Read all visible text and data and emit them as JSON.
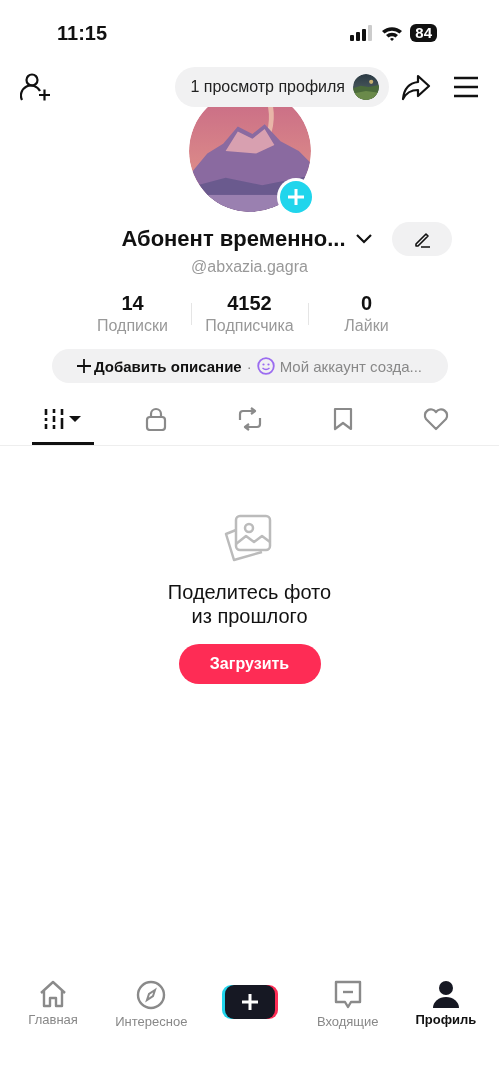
{
  "status_bar": {
    "time": "11:15",
    "battery": "84"
  },
  "top_bar": {
    "views_pill": "1 просмотр профиля"
  },
  "profile": {
    "name": "Абонент временно...",
    "username": "@abxazia.gagra",
    "stats": [
      {
        "value": "14",
        "label": "Подписки"
      },
      {
        "value": "4152",
        "label": "Подписчика"
      },
      {
        "value": "0",
        "label": "Лайки"
      }
    ],
    "bio": {
      "add_label": "Добавить описание",
      "separator": "·",
      "text": "Мой аккаунт созда..."
    }
  },
  "tabs": [
    {
      "kind": "grid",
      "selected": true
    },
    {
      "kind": "lock",
      "selected": false
    },
    {
      "kind": "repost",
      "selected": false
    },
    {
      "kind": "bookmark",
      "selected": false
    },
    {
      "kind": "heart",
      "selected": false
    }
  ],
  "empty_state": {
    "title": "Поделитесь фото\nиз прошлого",
    "button": "Загрузить"
  },
  "bottom_nav": [
    {
      "kind": "home",
      "label": "Главная",
      "selected": false
    },
    {
      "kind": "explore",
      "label": "Интересное",
      "selected": false
    },
    {
      "kind": "create",
      "selected": false
    },
    {
      "kind": "inbox",
      "label": "Входящие",
      "selected": false
    },
    {
      "kind": "profile",
      "label": "Профиль",
      "selected": true
    }
  ]
}
